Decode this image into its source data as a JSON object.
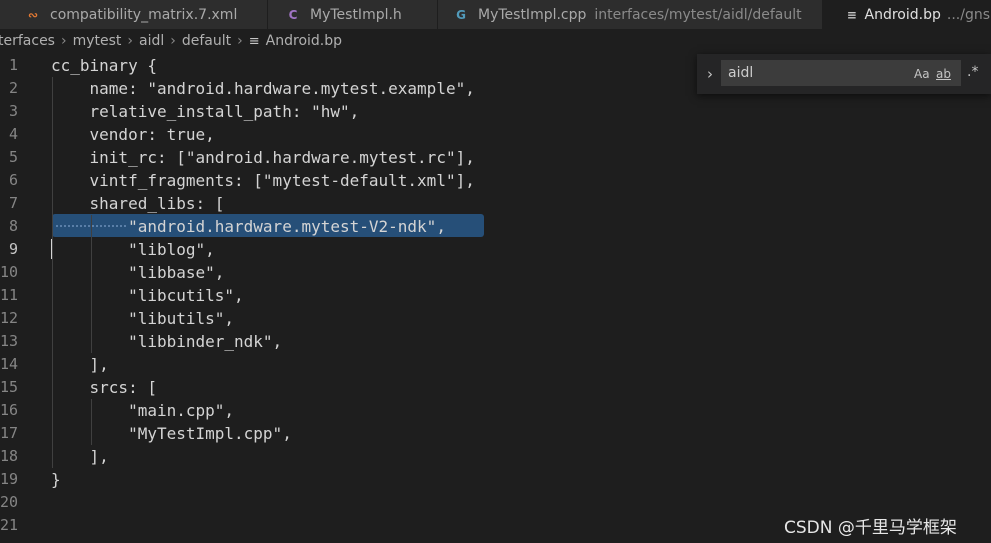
{
  "tabs": [
    {
      "label": "compatibility_matrix.7.xml",
      "icon": "rss-icon",
      "icon_glyph": ")",
      "icon_color": "#e37933",
      "desc": ""
    },
    {
      "label": "MyTestImpl.h",
      "icon": "c-file-icon",
      "icon_glyph": "C",
      "icon_color": "#a074c4",
      "desc": ""
    },
    {
      "label": "MyTestImpl.cpp",
      "icon": "cpp-file-icon",
      "icon_glyph": "G",
      "icon_color": "#519aba",
      "desc": "interfaces/mytest/aidl/default"
    },
    {
      "label": "Android.bp",
      "icon": "lines-file-icon",
      "icon_glyph": "≡",
      "icon_color": "#c5c5c5",
      "desc": ".../gns"
    }
  ],
  "breadcrumb": [
    "terfaces",
    "mytest",
    "aidl",
    "default",
    "Android.bp"
  ],
  "editor": {
    "lines": [
      "cc_binary {",
      "    name: \"android.hardware.mytest.example\",",
      "    relative_install_path: \"hw\",",
      "    vendor: true,",
      "    init_rc: [\"android.hardware.mytest.rc\"],",
      "    vintf_fragments: [\"mytest-default.xml\"],",
      "    shared_libs: [",
      "        \"android.hardware.mytest-V2-ndk\",",
      "        \"liblog\",",
      "        \"libbase\",",
      "        \"libcutils\",",
      "        \"libutils\",",
      "        \"libbinder_ndk\",",
      "    ],",
      "    srcs: [",
      "        \"main.cpp\",",
      "        \"MyTestImpl.cpp\",",
      "    ],",
      "}",
      "",
      ""
    ],
    "line_numbers": [
      "1",
      "2",
      "3",
      "4",
      "5",
      "6",
      "7",
      "8",
      "9",
      "10",
      "11",
      "12",
      "13",
      "14",
      "15",
      "16",
      "17",
      "18",
      "19",
      "20",
      "21"
    ],
    "active_line": 9,
    "selected_line": 8
  },
  "find": {
    "value": "aidl",
    "match_case": "Aa",
    "whole_word": "ab",
    "regex": ".*"
  },
  "watermark": "CSDN @千里马学框架"
}
